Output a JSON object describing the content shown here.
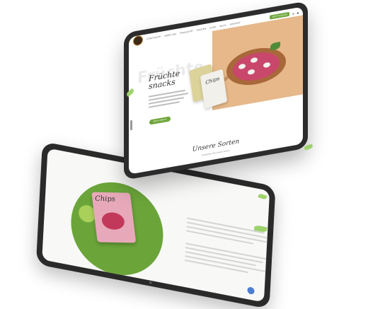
{
  "front": {
    "nav": {
      "items": [
        "STARTSEITE",
        "ÜBER UNS",
        "PRODUKTE",
        "SORTEN",
        "SHOP",
        "BLOG",
        "KONTAKT"
      ],
      "badge": "JETZT KAUFEN",
      "cart_icon": "cart-icon",
      "account_icon": "user-icon"
    },
    "hero": {
      "title_line1": "Früchte",
      "title_line2": "snacks",
      "bg_word": "Früchte",
      "button": "Mehr erfahren",
      "bag_label": "Chips"
    },
    "section": {
      "title": "Unsere Sorten",
      "subtitle": "Entdecken Sie unsere Sorten"
    }
  },
  "back": {
    "bag_label": "Chips"
  },
  "colors": {
    "brand_green": "#6ea63a",
    "bezel": "#2c2c2c",
    "bag_pink": "#e7a9b9"
  }
}
